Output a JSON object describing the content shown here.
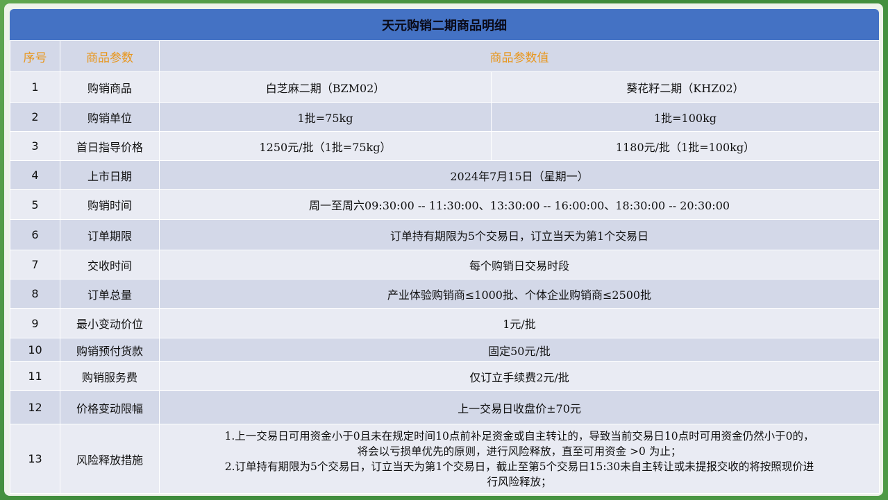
{
  "title": "天元购销二期商品明细",
  "header": {
    "col1": "序号",
    "col2": "商品参数",
    "col3": "商品参数值"
  },
  "rows": [
    {
      "no": "1",
      "param": "购销商品",
      "a": "白芝麻二期（BZM02）",
      "b": "葵花籽二期（KHZ02）"
    },
    {
      "no": "2",
      "param": "购销单位",
      "a": "1批=75kg",
      "b": "1批=100kg"
    },
    {
      "no": "3",
      "param": "首日指导价格",
      "a": "1250元/批（1批=75kg）",
      "b": "1180元/批（1批=100kg）"
    },
    {
      "no": "4",
      "param": "上市日期",
      "value": "2024年7月15日（星期一）"
    },
    {
      "no": "5",
      "param": "购销时间",
      "value": "周一至周六09:30:00 -- 11:30:00、13:30:00 -- 16:00:00、18:30:00 -- 20:30:00"
    },
    {
      "no": "6",
      "param": "订单期限",
      "value": "订单持有期限为5个交易日，订立当天为第1个交易日"
    },
    {
      "no": "7",
      "param": "交收时间",
      "value": "每个购销日交易时段"
    },
    {
      "no": "8",
      "param": "订单总量",
      "value": "产业体验购销商≤1000批、个体企业购销商≤2500批"
    },
    {
      "no": "9",
      "param": "最小变动价位",
      "value": "1元/批"
    },
    {
      "no": "10",
      "param": "购销预付货款",
      "value": "固定50元/批"
    },
    {
      "no": "11",
      "param": "购销服务费",
      "value": "仅订立手续费2元/批"
    },
    {
      "no": "12",
      "param": "价格变动限幅",
      "value": "上一交易日收盘价±70元"
    },
    {
      "no": "13",
      "param": "风险释放措施",
      "lines": [
        "1.上一交易日可用资金小于0且未在规定时间10点前补足资金或自主转让的，导致当前交易日10点时可用资金仍然小于0的，",
        "将会以亏损单优先的原则，进行风险释放，直至可用资金 >0 为止；",
        "2.订单持有期限为5个交易日，订立当天为第1个交易日，截止至第5个交易日15:30未自主转让或未提报交收的将按照现价进",
        "行风险释放；"
      ]
    }
  ]
}
